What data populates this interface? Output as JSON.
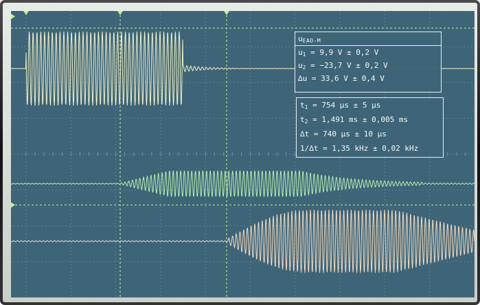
{
  "theme": {
    "screen_bg": "#3e6478",
    "grid": "#8fb0bc",
    "ch1_color": "#f2f3c8",
    "ch2_color": "#b4f0b0",
    "ch3_color": "#f3dcc0",
    "cursor_color": "#c8f08a"
  },
  "channel_markers": {
    "trigger_top_icon": "triangle-down-icon",
    "ch1_marker_icon": "triangle-right-icon",
    "ch2_marker_icon": "triangle-right-icon",
    "ch3_marker_icon": "triangle-right-icon"
  },
  "voltage_readout": {
    "label_main": "u",
    "label_sub": "EAO-M",
    "rows": [
      {
        "name": "u",
        "sub": "1",
        "text": " = 9,9 V ± 0,2 V"
      },
      {
        "name": "u",
        "sub": "2",
        "text": " = −23,7 V ± 0,2 V"
      },
      {
        "name": "∆u",
        "sub": "",
        "text": " = 33,6 V ± 0,4 V"
      }
    ]
  },
  "time_readout": {
    "rows": [
      {
        "name": "t",
        "sub": "1",
        "text": " = 754 µs ± 5 µs"
      },
      {
        "name": "t",
        "sub": "2",
        "text": " = 1,491 ms ± 0,005 ms"
      },
      {
        "name": "∆t",
        "sub": "",
        "text": " = 740 µs ± 10 µs"
      },
      {
        "name": "1/∆t",
        "sub": "",
        "text": " = 1,35 kHz ± 0,02 kHz"
      }
    ]
  }
}
